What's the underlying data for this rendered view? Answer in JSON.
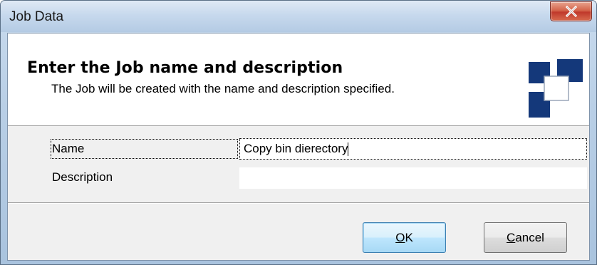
{
  "window": {
    "title": "Job Data",
    "close_label": "X"
  },
  "header": {
    "heading": "Enter the Job name and description",
    "subheading": "The Job will be created with the name and description specified."
  },
  "form": {
    "name_label": "Name",
    "name_value": "Copy bin dierectory",
    "description_label": "Description",
    "description_value": ""
  },
  "buttons": {
    "ok_label": "OK",
    "ok_mnemonic": "O",
    "ok_rest": "K",
    "cancel_label": "Cancel",
    "cancel_mnemonic": "C",
    "cancel_rest": "ancel"
  },
  "colors": {
    "logo_blue": "#14387a",
    "close_red": "#c0392b",
    "window_frame": "#b9cfe6"
  },
  "icons": {
    "close": "close-icon",
    "logo": "wizard-logo-icon"
  }
}
